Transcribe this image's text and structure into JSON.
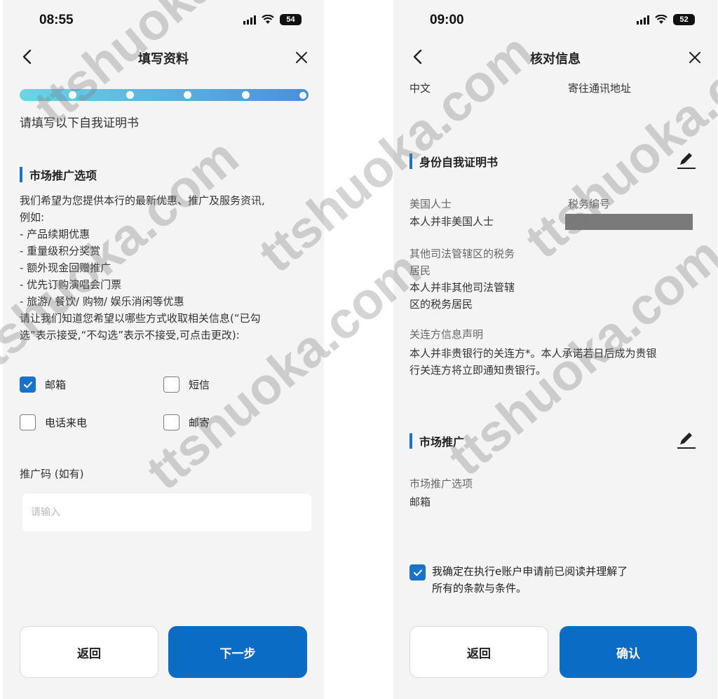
{
  "left": {
    "status": {
      "time": "08:55",
      "battery": "54"
    },
    "nav": {
      "title": "填写资料"
    },
    "heading": "请填写以下自我证明书",
    "section_title": "市场推广选项",
    "intro_lines": [
      "我们希望为您提供本行的最新优惠、推广及服务资讯,",
      "例如:",
      "- 产品续期优惠",
      "- 重量级积分奖赏",
      "- 额外现金回赠推广",
      "- 优先订购演唱会门票",
      "- 旅游/ 餐饮/ 购物/ 娱乐消闲等优惠",
      "请让我们知道您希望以哪些方式收取相关信息(“已勾",
      "选”表示接受,“不勾选”表示不接受,可点击更改):"
    ],
    "options": [
      {
        "label": "邮箱",
        "checked": true
      },
      {
        "label": "短信",
        "checked": false
      },
      {
        "label": "电话来电",
        "checked": false
      },
      {
        "label": "邮寄",
        "checked": false
      }
    ],
    "referral": {
      "label": "推广码 (如有)",
      "placeholder": "请输入"
    },
    "buttons": {
      "back": "返回",
      "next": "下一步"
    }
  },
  "right": {
    "status": {
      "time": "09:00",
      "battery": "52"
    },
    "nav": {
      "title": "核对信息"
    },
    "top_row": {
      "left": "中文",
      "right": "寄往通讯地址"
    },
    "identity": {
      "title": "身份自我证明书",
      "us_person": {
        "label": "美国人士",
        "value": "本人并非美国人士"
      },
      "tax_no": {
        "label": "税务编号"
      },
      "other_tax": {
        "label_lines": [
          "其他司法管辖区的税务",
          "居民"
        ],
        "value_lines": [
          "本人并非其他司法管辖",
          "区的税务居民"
        ]
      },
      "related": {
        "label": "关连方信息声明",
        "value_lines": [
          "本人并非贵银行的关连方*。本人承诺若日后成为贵银",
          "行关连方将立即通知贵银行。"
        ]
      }
    },
    "marketing": {
      "title": "市场推广",
      "option_label": "市场推广选项",
      "option_value": "邮箱"
    },
    "agreement": {
      "checked": true,
      "lines": [
        "我确定在执行e账户申请前已阅读并理解了",
        "所有的条款与条件。"
      ]
    },
    "buttons": {
      "back": "返回",
      "confirm": "确认"
    }
  },
  "watermark": "ttshuoka.com",
  "colors": {
    "primary": "#0a6cc4",
    "accent_bar": "#1a73c9",
    "background": "#f4f4f4"
  }
}
